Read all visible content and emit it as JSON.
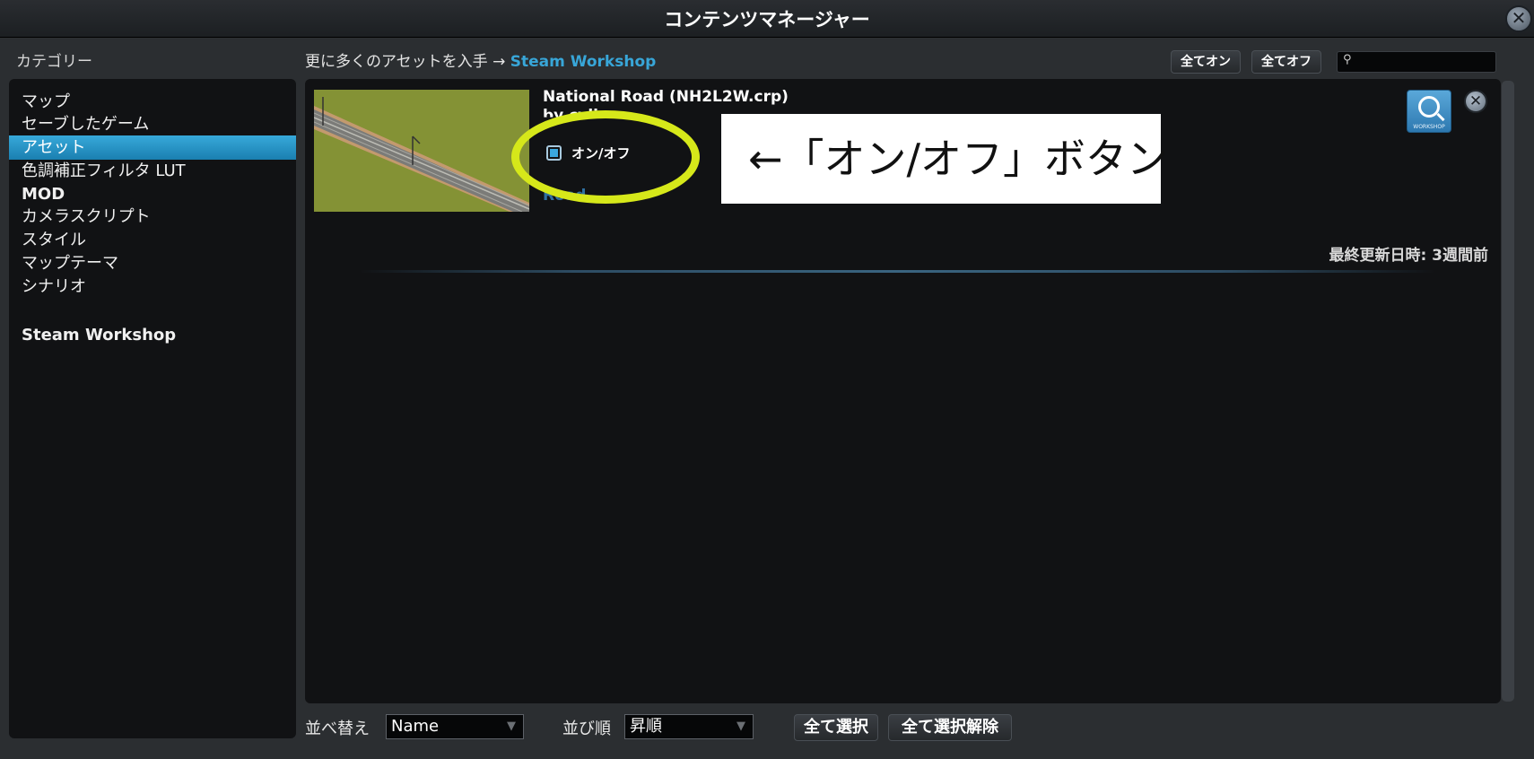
{
  "window": {
    "title": "コンテンツマネージャー",
    "close_glyph": "✕"
  },
  "sidebar": {
    "heading": "カテゴリー",
    "items": [
      {
        "label": "マップ",
        "selected": false
      },
      {
        "label": "セーブしたゲーム",
        "selected": false
      },
      {
        "label": "アセット",
        "selected": true
      },
      {
        "label": "色調補正フィルタ LUT",
        "selected": false
      },
      {
        "label": "MOD",
        "selected": false
      },
      {
        "label": "カメラスクリプト",
        "selected": false
      },
      {
        "label": "スタイル",
        "selected": false
      },
      {
        "label": "マップテーマ",
        "selected": false
      },
      {
        "label": "シナリオ",
        "selected": false
      }
    ],
    "workshop": "Steam Workshop"
  },
  "topbar": {
    "more_assets_prefix": "更に多くのアセットを入手 → ",
    "more_assets_link": "Steam Workshop",
    "all_on": "全てオン",
    "all_off": "全てオフ",
    "search_value": "",
    "search_icon": "search-icon"
  },
  "asset": {
    "name": "National Road (NH2L2W.crp)",
    "author": "by cylis",
    "toggle_label": "オン/オフ",
    "enabled": true,
    "type": "Road",
    "updated": "最終更新日時: 3週間前",
    "workshop_caption": "WORKSHOP",
    "close_glyph": "✕"
  },
  "annotation": {
    "text": "←「オン/オフ」ボタン",
    "highlight_color": "#d6e81a"
  },
  "bottom": {
    "sort_label": "並べ替え",
    "sort_value": "Name",
    "order_label": "並び順",
    "order_value": "昇順",
    "select_all": "全て選択",
    "deselect_all": "全て選択解除",
    "dropdown_arrow": "▼"
  },
  "colors": {
    "accent": "#38a6d8",
    "selected_bg": "#2a95c8"
  }
}
